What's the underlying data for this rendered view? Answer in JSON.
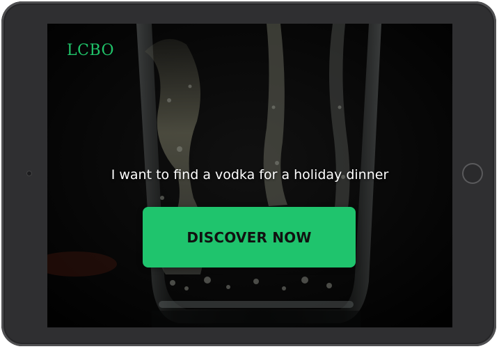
{
  "device": {
    "frame_color": "#2f2f31"
  },
  "brand": {
    "logo_text": "LCBO",
    "logo_color": "#20c46a"
  },
  "hero": {
    "background_image": "glass-splash-photo",
    "tagline": "I want to find a vodka for a holiday dinner",
    "cta_label": "DISCOVER NOW",
    "cta_color": "#1fc46d"
  }
}
